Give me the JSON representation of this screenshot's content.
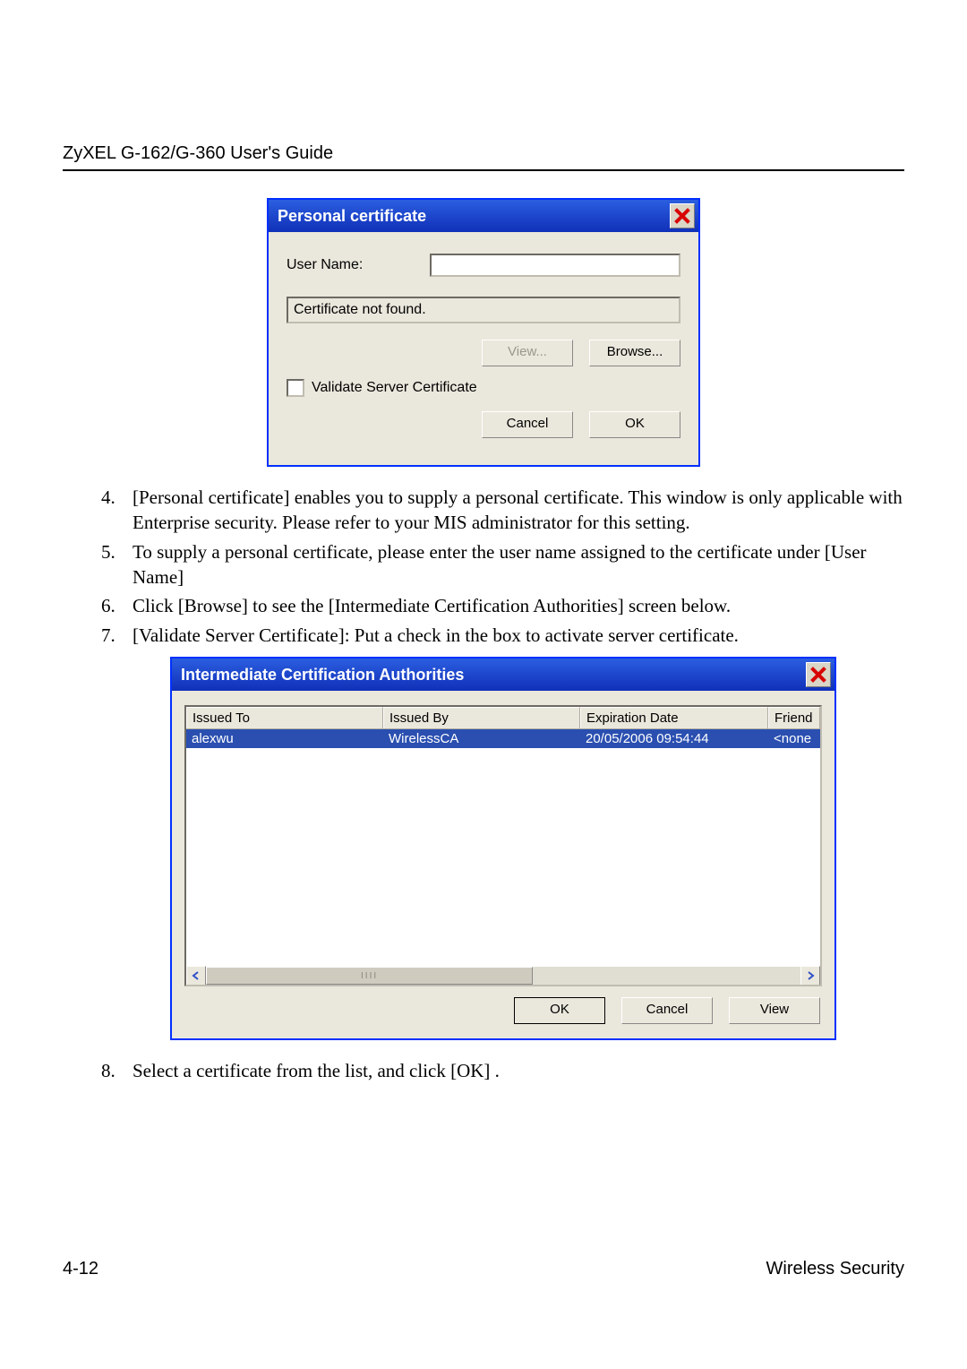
{
  "header": "ZyXEL G-162/G-360 User's Guide",
  "personal_dialog": {
    "title": "Personal certificate",
    "user_name_label": "User Name:",
    "cert_status": "Certificate not found.",
    "view_btn": "View...",
    "browse_btn": "Browse...",
    "validate_label": "Validate Server Certificate",
    "cancel_btn": "Cancel",
    "ok_btn": "OK"
  },
  "steps": {
    "s4": "[Personal certificate] enables you to supply a personal certificate.  This window is only applicable with Enterprise security.  Please refer to your MIS administrator for this setting.",
    "s5": "To supply a personal certificate, please enter the user name assigned to the certificate under [User Name]",
    "s6": "Click [Browse] to see the [Intermediate Certification Authorities] screen below.",
    "s7": "[Validate Server Certificate]: Put a check in the box to activate server certificate.",
    "s8": "Select a certificate from the list, and click [OK] ."
  },
  "ica_dialog": {
    "title": "Intermediate Certification Authorities",
    "columns": {
      "c0": "Issued To",
      "c1": "Issued By",
      "c2": "Expiration Date",
      "c3": "Friend"
    },
    "row": {
      "c0": "alexwu",
      "c1": "WirelessCA",
      "c2": "20/05/2006 09:54:44",
      "c3": "<none"
    },
    "ok_btn": "OK",
    "cancel_btn": "Cancel",
    "view_btn": "View"
  },
  "footer": {
    "left": "4-12",
    "right": "Wireless Security"
  }
}
